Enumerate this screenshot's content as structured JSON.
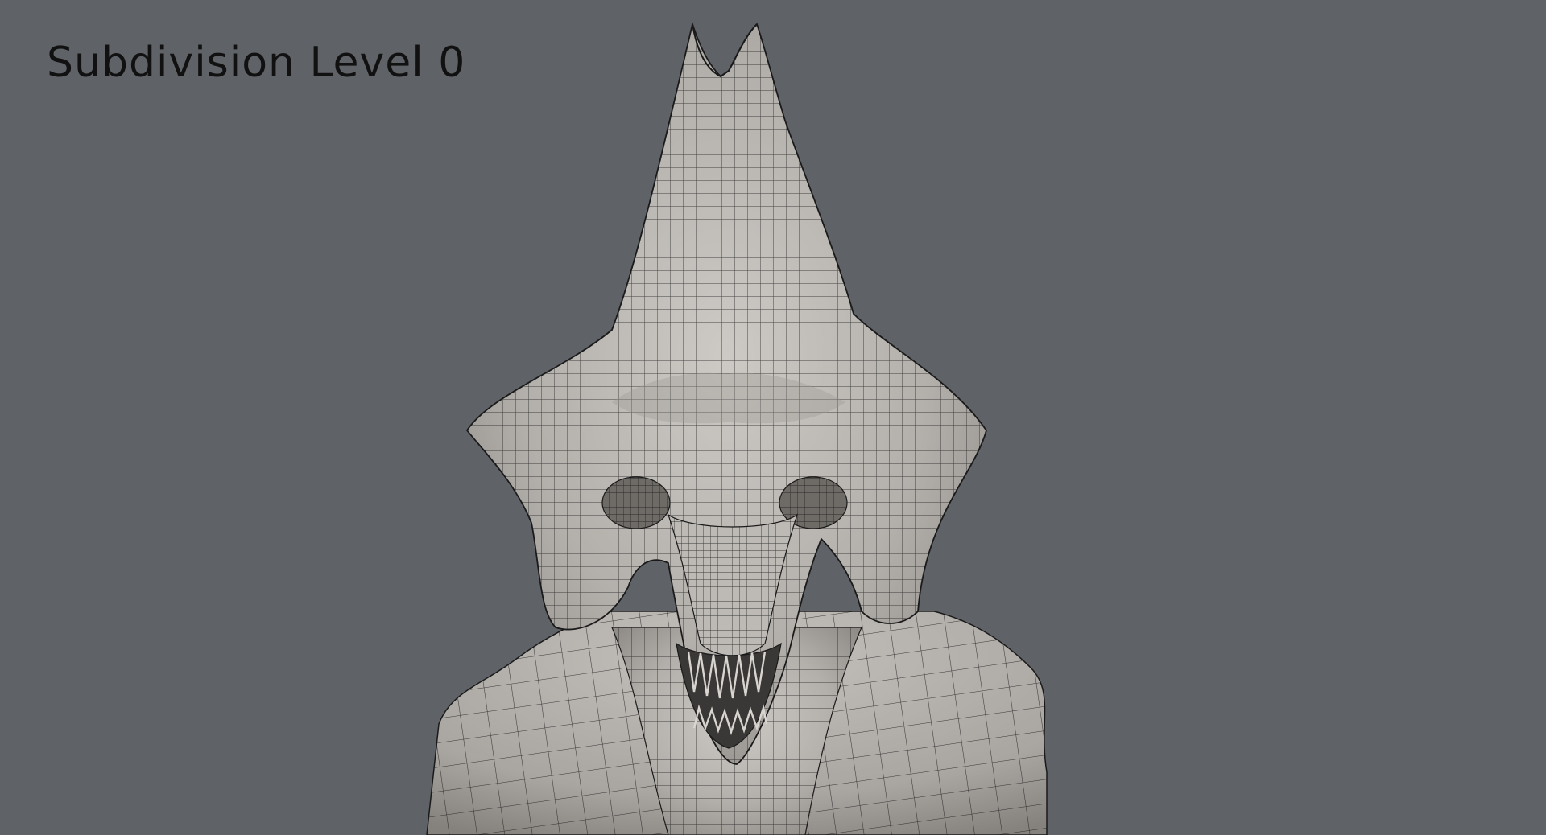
{
  "viewport": {
    "caption": "Subdivision Level 0",
    "background_color": "#5f6367",
    "model_color": "#b9b5b1",
    "wire_color": "#1a1a1a",
    "model_icon": "creature-head-mesh"
  }
}
